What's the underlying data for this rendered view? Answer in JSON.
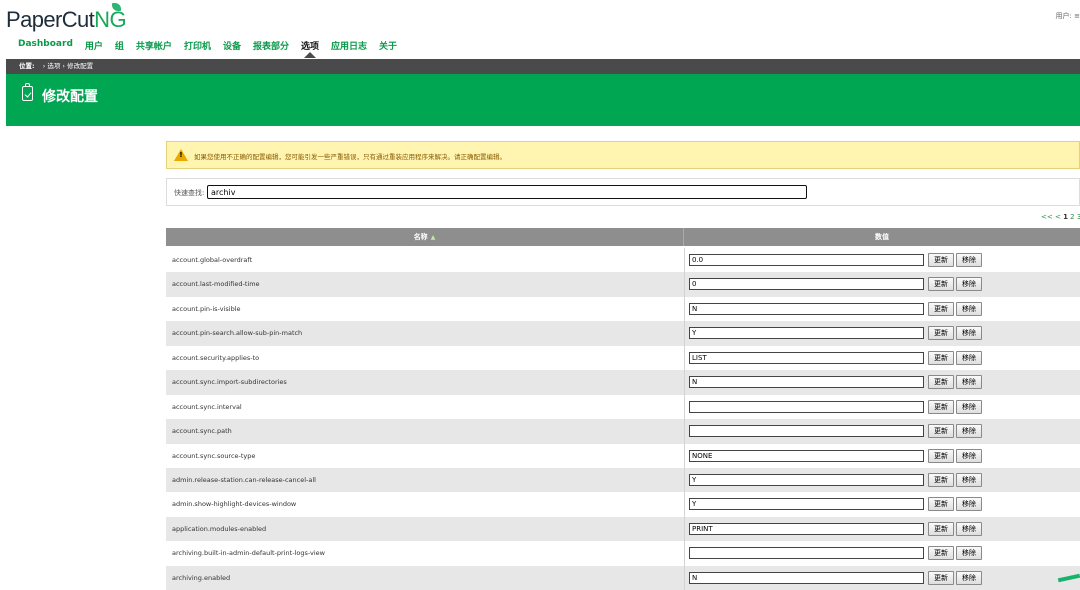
{
  "header": {
    "logo_main": "PaperCut",
    "logo_ng": "NG",
    "user_label": "用户: ≡"
  },
  "nav": {
    "items": [
      "Dashboard",
      "用户",
      "组",
      "共享帐户",
      "打印机",
      "设备",
      "报表部分",
      "选项",
      "应用日志",
      "关于"
    ],
    "active": "选项"
  },
  "breadcrumb": {
    "label": "位置:",
    "path": "› 选项 › 修改配置"
  },
  "page": {
    "title": "修改配置"
  },
  "warning": {
    "text": "如果您使用不正确的配置编辑，您可能引发一些严重错误，只有通过重装应用程序来解决。请正确配置编辑。"
  },
  "search": {
    "label": "快速查找:",
    "value": "archiv"
  },
  "pager": {
    "prev": "<< <",
    "pages": [
      "1",
      "2",
      "3"
    ],
    "current": "1"
  },
  "table": {
    "col_name": "名称",
    "col_value": "数值",
    "update_label": "更新",
    "remove_label": "移除",
    "rows": [
      {
        "name": "account.global-overdraft",
        "value": "0.0"
      },
      {
        "name": "account.last-modified-time",
        "value": "0"
      },
      {
        "name": "account.pin-is-visible",
        "value": "N"
      },
      {
        "name": "account.pin-search.allow-sub-pin-match",
        "value": "Y"
      },
      {
        "name": "account.security.applies-to",
        "value": "LIST"
      },
      {
        "name": "account.sync.import-subdirectories",
        "value": "N"
      },
      {
        "name": "account.sync.interval",
        "value": ""
      },
      {
        "name": "account.sync.path",
        "value": ""
      },
      {
        "name": "account.sync.source-type",
        "value": "NONE"
      },
      {
        "name": "admin.release-station.can-release-cancel-all",
        "value": "Y"
      },
      {
        "name": "admin.show-highlight-devices-window",
        "value": "Y"
      },
      {
        "name": "application.modules-enabled",
        "value": "PRINT"
      },
      {
        "name": "archiving.built-in-admin-default-print-logs-view",
        "value": ""
      },
      {
        "name": "archiving.enabled",
        "value": "N"
      }
    ]
  },
  "colors": {
    "brand_green": "#00a652",
    "nav_green": "#0a9a4b",
    "dark_bar": "#4a4a4a",
    "warning_bg": "#fff5b0",
    "header_gray": "#8e8e8e"
  }
}
